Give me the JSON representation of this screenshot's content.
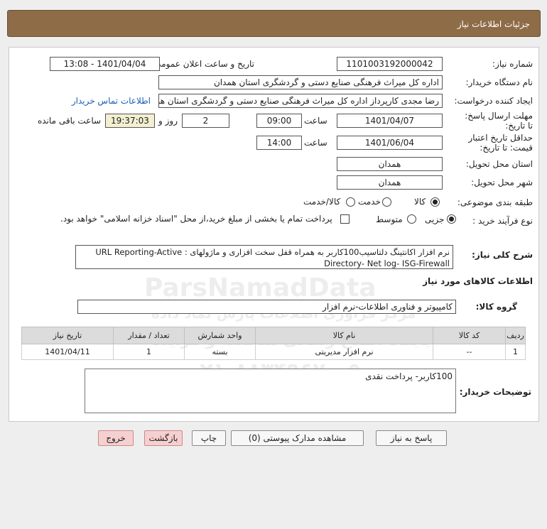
{
  "header": {
    "title": "جزئیات اطلاعات نیاز"
  },
  "need_number": {
    "label": "شماره نیاز:",
    "value": "1101003192000042"
  },
  "announce": {
    "label": "تاریخ و ساعت اعلان عمومی:",
    "value": "1401/04/04 - 13:08"
  },
  "buyer_org": {
    "label": "نام دستگاه خریدار:",
    "value": "اداره کل میراث فرهنگی  صنایع دستی و گردشگری استان همدان"
  },
  "requester": {
    "label": "ایجاد کننده درخواست:",
    "value": "رضا مجدی کارپرداز اداره کل میراث فرهنگی  صنایع دستی و گردشگری استان همدان",
    "link": "اطلاعات تماس خریدار"
  },
  "deadline": {
    "label": "مهلت ارسال پاسخ: تا تاریخ:",
    "date": "1401/04/07",
    "time_label": "ساعت",
    "time": "09:00",
    "days": "2",
    "days_label": "روز و",
    "remaining": "19:37:03",
    "remaining_label": "ساعت باقی مانده"
  },
  "validity": {
    "label": "حداقل تاریخ اعتبار قیمت: تا تاریخ:",
    "date": "1401/06/04",
    "time_label": "ساعت",
    "time": "14:00"
  },
  "province": {
    "label": "استان محل تحویل:",
    "value": "همدان"
  },
  "city": {
    "label": "شهر محل تحویل:",
    "value": "همدان"
  },
  "category": {
    "label": "طبقه بندی موضوعی:",
    "options": [
      "کالا",
      "خدمت",
      "کالا/خدمت"
    ],
    "selected": "کالا"
  },
  "process": {
    "label": "نوع فرآیند خرید :",
    "options": [
      "جزیی",
      "متوسط"
    ],
    "selected": "جزیی",
    "checkbox_text": "پرداخت تمام یا بخشی از مبلغ خرید،از محل \"اسناد خزانه اسلامی\" خواهد بود."
  },
  "summary": {
    "label": "شرح کلی نیاز:",
    "line1": "نرم افزار اکانتینگ دلتاسیب100کاربر به همراه قفل سخت افزاری و ماژولهای : URL Reporting-Active",
    "line2": "Directory- Net log- ISG-Firewall"
  },
  "goods_info": {
    "title": "اطلاعات کالاهای مورد نیاز"
  },
  "goods_group": {
    "label": "گروه کالا:",
    "value": "کامپیوتر و فناوری اطلاعات-نرم افزار"
  },
  "table": {
    "headers": [
      "ردیف",
      "کد کالا",
      "نام کالا",
      "واحد شمارش",
      "تعداد / مقدار",
      "تاریخ نیاز"
    ],
    "rows": [
      [
        "1",
        "--",
        "نرم افزار مدیریتی",
        "بسته",
        "1",
        "1401/04/11"
      ]
    ]
  },
  "buyer_notes": {
    "label": "توضیحات خریدار:",
    "value": "100کاربر- پرداخت نقدی"
  },
  "buttons": {
    "reply": "پاسخ به نیاز",
    "attachments": "مشاهده مدارک پیوستی (0)",
    "print": "چاپ",
    "back": "بازگشت",
    "exit": "خروج"
  },
  "watermark": {
    "brand": "ParsNamadData",
    "tagline": "مرکز فراوری اطلاعات پارس نماد داده",
    "site": "پایگاه اطلاع رسانی مناقصه و مزایده",
    "phone": "۰۲۱-۸۸۳۴۹۶۷۰-۵"
  }
}
